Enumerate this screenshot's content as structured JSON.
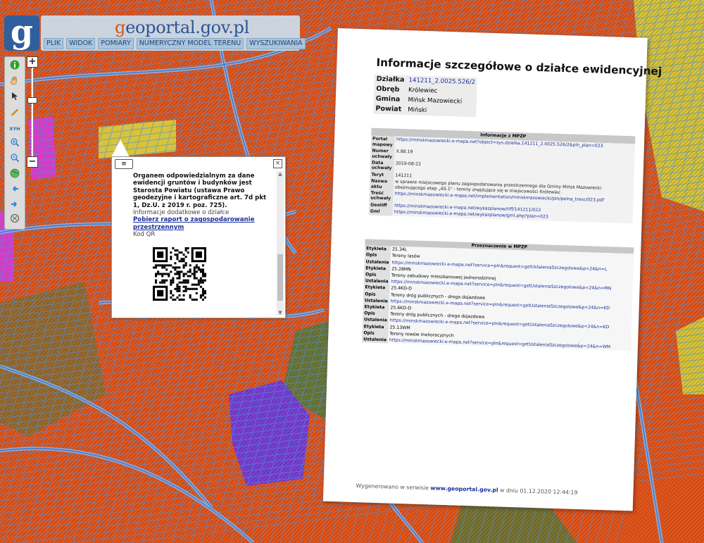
{
  "header": {
    "logo_letter": "g",
    "title_g": "g",
    "title_rest": "eoportal",
    "title_domain": ".gov.pl",
    "menu": [
      "PLIK",
      "WIDOK",
      "POMIARY",
      "NUMERYCZNY MODEL TERENU",
      "WYSZUKIWANIA"
    ]
  },
  "toolbar": {
    "icons": [
      "info-icon",
      "hand-pan-icon",
      "cursor-arrow-icon",
      "pencil-icon",
      "xyh-icon",
      "zoom-in-icon",
      "zoom-out-icon",
      "globe-icon",
      "arrow-back-icon",
      "arrow-forward-icon",
      "compass-icon"
    ],
    "xyh_label": "XYH",
    "zoom_plus": "+",
    "zoom_minus": "−"
  },
  "popup": {
    "list_icon": "≡",
    "close_icon": "×",
    "authority_text": "Organem odpowiedzialnym za dane ewidencji gruntów i budynków jest Starosta Powiatu (ustawa Prawo geodezyjne i kartograficzne art. 7d pkt 1, Dz.U. z 2019 r. poz. 725).",
    "info_label": "Informacje dodatkowe o działce",
    "report_link": "Pobierz raport o zagospodarowanie przestrzennym",
    "qr_label": "Kod QR"
  },
  "sheet": {
    "title": "Informacje szczegółowe o działce ewidencyjnej",
    "summary": [
      {
        "k": "Działka",
        "v": "141211_2.0025.526/2",
        "link": true
      },
      {
        "k": "Obręb",
        "v": "Królewiec",
        "link": false
      },
      {
        "k": "Gmina",
        "v": "Mińsk Mazowiecki",
        "link": false
      },
      {
        "k": "Powiat",
        "v": "Miński",
        "link": false
      }
    ],
    "mpzp_header": "Informacje z MPZP",
    "mpzp": [
      {
        "k": "Portal mapowy",
        "v": "https://minskmazowiecki.e-mapa.net?object=sys.dzialka.141211_2.0025.526/2&pln_plan=023",
        "link": true
      },
      {
        "k": "Numer uchwały",
        "v": "X.88.19",
        "link": false
      },
      {
        "k": "Data uchwały",
        "v": "2019-08-22",
        "link": false
      },
      {
        "k": "Teryt",
        "v": "141211",
        "link": false
      },
      {
        "k": "Nazwa aktu",
        "v": "w sprawie miejscowego planu zagospodarowania przestrzennego dla Gminy Mińsk Mazowiecki obejmującego etap „AS.1\" - tereny znajdujące się w miejscowości Królewiec",
        "link": false
      },
      {
        "k": "Treść uchwały",
        "v": "https://minskmazowiecki.e-mapa.net/implementation/minskmazowiecki/pln/pelna_tresc/023.pdf",
        "link": true
      },
      {
        "k": "Geotiff",
        "v": "https://minskmazowiecki.e-mapa.net/wykazplanow/tiff/141211/023",
        "link": true
      },
      {
        "k": "Gml",
        "v": "https://minskmazowiecki.e-mapa.net/wykazplanow/gml.php?plan=023",
        "link": true
      }
    ],
    "przezn_header": "Przeznaczenie w MPZP",
    "przezn": [
      {
        "k": "Etykieta",
        "v": "25.34L",
        "link": false
      },
      {
        "k": "Opis",
        "v": "Tereny lasów",
        "link": false
      },
      {
        "k": "Ustalenia",
        "v": "https://minskmazowiecki.e-mapa.net?service=pln&request=getUstaleniaSzczegolowe&p=24&n=L",
        "link": true
      },
      {
        "k": "Etykieta",
        "v": "25.28MN",
        "link": false
      },
      {
        "k": "Opis",
        "v": "Tereny zabudowy mieszkaniowej jednorodzinnej",
        "link": false
      },
      {
        "k": "Ustalenia",
        "v": "https://minskmazowiecki.e-mapa.net?service=pln&request=getUstaleniaSzczegolowe&p=24&n=MN",
        "link": true
      },
      {
        "k": "Etykieta",
        "v": "25.4KD-D",
        "link": false
      },
      {
        "k": "Opis",
        "v": "Tereny dróg publicznych - droga dojazdowa",
        "link": false
      },
      {
        "k": "Ustalenia",
        "v": "https://minskmazowiecki.e-mapa.net?service=pln&request=getUstaleniaSzczegolowe&p=24&n=KD",
        "link": true
      },
      {
        "k": "Etykieta",
        "v": "25.6KD-D",
        "link": false
      },
      {
        "k": "Opis",
        "v": "Tereny dróg publicznych - droga dojazdowa",
        "link": false
      },
      {
        "k": "Ustalenia",
        "v": "https://minskmazowiecki.e-mapa.net?service=pln&request=getUstaleniaSzczegolowe&p=24&n=KD",
        "link": true
      },
      {
        "k": "Etykieta",
        "v": "25.13WM",
        "link": false
      },
      {
        "k": "Opis",
        "v": "Tereny rowów melioracyjnych",
        "link": false
      },
      {
        "k": "Ustalenia",
        "v": "https://minskmazowiecki.e-mapa.net?service=pln&request=getUstaleniaSzczegolowe&p=24&n=WM",
        "link": true
      }
    ],
    "footer_prefix": "Wygenerowano w serwisie",
    "footer_link": "www.geoportal.gov.pl",
    "footer_suffix": "w dniu 01.12.2020 12:44:19"
  },
  "colors": {
    "brand_blue": "#2f5f9c",
    "map_orange": "#e0561c",
    "parcel_blue": "#4a8fe0",
    "zone_purple": "#7a3fd0",
    "zone_magenta": "#d43cc4",
    "zone_yellow": "#d8c43a"
  }
}
